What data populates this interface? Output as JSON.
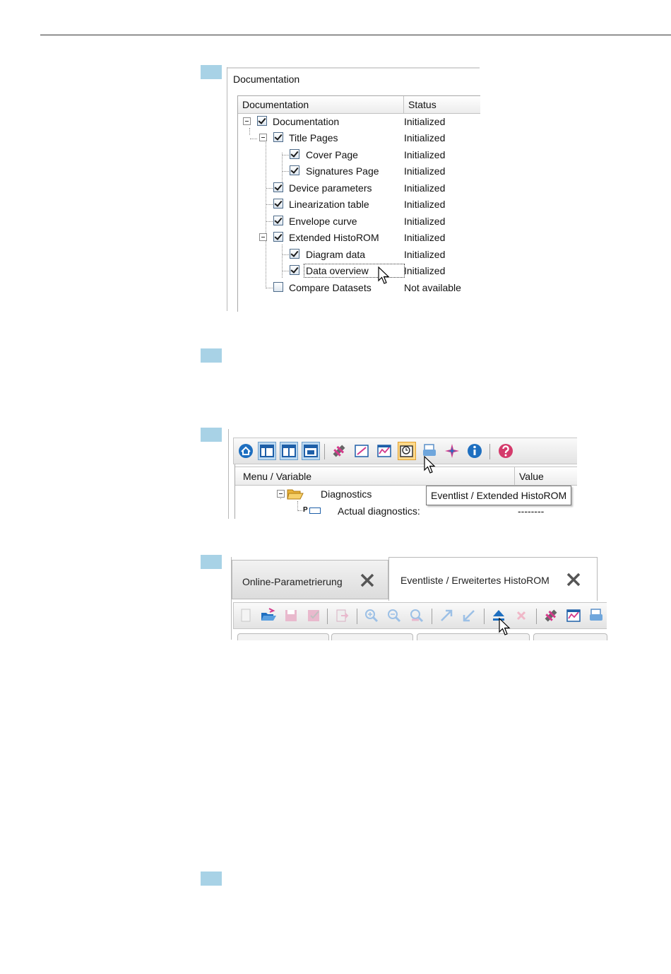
{
  "shot1": {
    "panel_title": "Documentation",
    "col_documentation": "Documentation",
    "col_status": "Status",
    "rows": [
      {
        "label": "Documentation",
        "status": "Initialized",
        "checked": true
      },
      {
        "label": "Title Pages",
        "status": "Initialized",
        "checked": true
      },
      {
        "label": "Cover Page",
        "status": "Initialized",
        "checked": true
      },
      {
        "label": "Signatures Page",
        "status": "Initialized",
        "checked": true
      },
      {
        "label": "Device parameters",
        "status": "Initialized",
        "checked": true
      },
      {
        "label": "Linearization table",
        "status": "Initialized",
        "checked": true
      },
      {
        "label": "Envelope curve",
        "status": "Initialized",
        "checked": true
      },
      {
        "label": "Extended HistoROM",
        "status": "Initialized",
        "checked": true
      },
      {
        "label": "Diagram data",
        "status": "Initialized",
        "checked": true
      },
      {
        "label": "Data overview",
        "status": "Initialized",
        "checked": true
      },
      {
        "label": "Compare Datasets",
        "status": "Not available",
        "checked": false
      }
    ]
  },
  "shot2": {
    "col_menu": "Menu / Variable",
    "col_value": "Value",
    "row_diagnostics": "Diagnostics",
    "row_actual": "Actual diagnostics:",
    "row_actual_value": "--------",
    "param_marker": "P",
    "tooltip": "Eventlist / Extended HistoROM",
    "icons": [
      "home-icon",
      "layout-1-icon",
      "layout-2-icon",
      "layout-3-icon",
      "satellite-icon",
      "chart-edit-icon",
      "envelope-chart-icon",
      "eventlist-historom-icon",
      "print-icon",
      "magic-wand-icon",
      "info-icon",
      "help-icon"
    ]
  },
  "shot3": {
    "tab_online": "Online-Parametrierung",
    "tab_eventlist": "Eventliste / Erweitertes HistoROM",
    "icons": [
      "new-icon",
      "open-icon",
      "save-icon",
      "save-as-icon",
      "export-icon",
      "zoom-in-icon",
      "zoom-out-icon",
      "zoom-reset-icon",
      "expand-icon",
      "collapse-icon",
      "upload-icon",
      "delete-icon",
      "satellite-icon",
      "chart-icon",
      "print-icon"
    ]
  },
  "colors": {
    "step_marker": "#a8d2e6",
    "close_x": "#555555",
    "accent_blue": "#1e6fc0"
  }
}
